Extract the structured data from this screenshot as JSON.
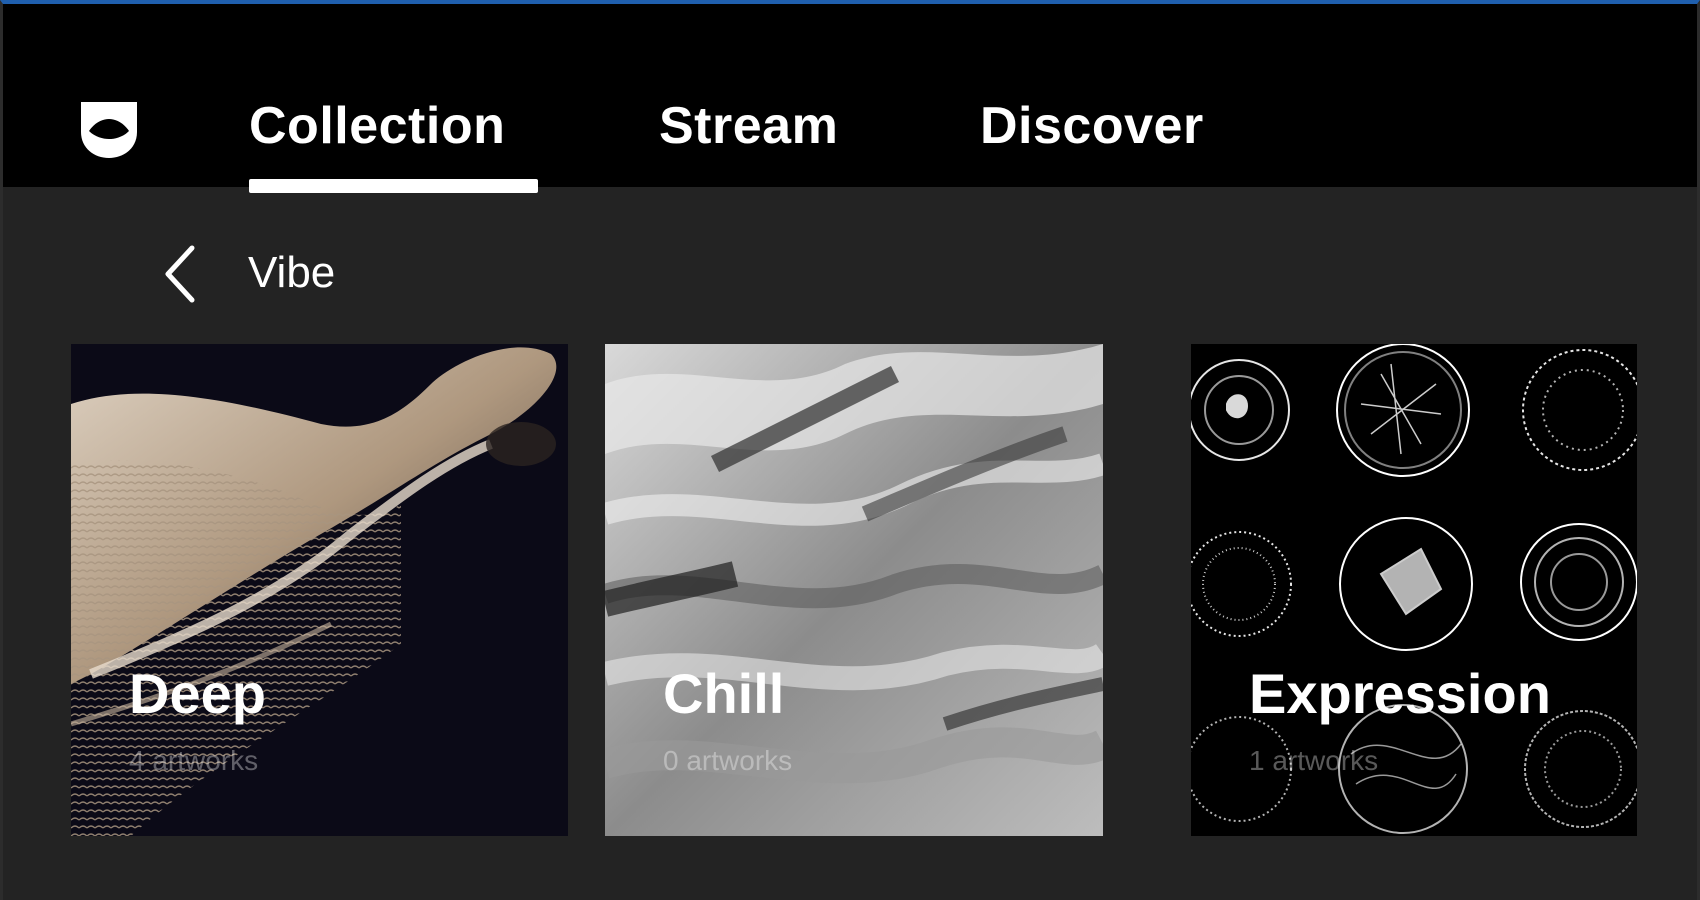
{
  "nav": {
    "logo_icon": "eye-shield-logo-icon",
    "tabs": [
      {
        "label": "Collection",
        "active": true
      },
      {
        "label": "Stream",
        "active": false
      },
      {
        "label": "Discover",
        "active": false
      }
    ]
  },
  "breadcrumb": {
    "back_icon": "chevron-left-icon",
    "title": "Vibe"
  },
  "cards": [
    {
      "title": "Deep",
      "count": "4 artworks"
    },
    {
      "title": "Chill",
      "count": "0 artworks"
    },
    {
      "title": "Expression",
      "count": "1 artworks"
    }
  ],
  "colors": {
    "topbar": "#000000",
    "background": "#232323",
    "window_accent": "#1f5fae",
    "text": "#ffffff"
  }
}
